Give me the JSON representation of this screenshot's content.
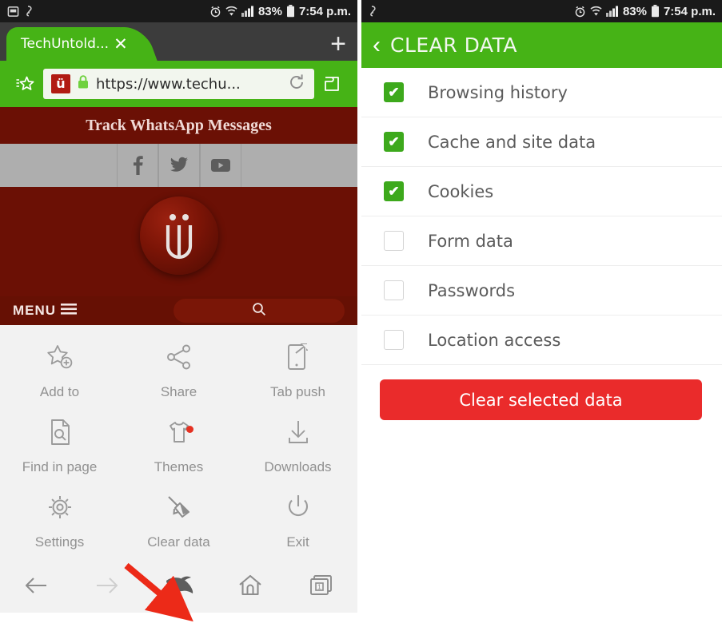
{
  "status_bar": {
    "left_icons": [
      "sdcard-icon",
      "app-notification-icon"
    ],
    "alarm_icon": "alarm-icon",
    "wifi_icon": "wifi-icon",
    "signal_icon": "signal-bars-icon",
    "battery_percent": "83%",
    "battery_icon": "battery-icon",
    "time": "7:54 p.m."
  },
  "browser": {
    "tab": {
      "title": "TechUntold...",
      "close_label": "✕"
    },
    "new_tab_label": "+",
    "bookmark_icon": "bookmark-star-icon",
    "favicon_letter": "ü",
    "lock_icon": "lock-icon",
    "url": "https://www.techu...",
    "reload_icon": "reload-icon",
    "extension_icon": "puzzle-extension-icon"
  },
  "webpage": {
    "title": "Track WhatsApp Messages",
    "social": [
      {
        "name": "facebook-icon",
        "glyph": "f"
      },
      {
        "name": "twitter-icon",
        "glyph": "t"
      },
      {
        "name": "youtube-icon",
        "glyph": "y"
      }
    ],
    "logo_letter": "ü",
    "menu_label": "MENU",
    "search_icon": "search-icon"
  },
  "menu_grid": {
    "rows": [
      [
        {
          "label": "Add to",
          "icon": "star-add-icon",
          "badge": false
        },
        {
          "label": "Share",
          "icon": "share-icon",
          "badge": false
        },
        {
          "label": "Tab push",
          "icon": "tab-push-icon",
          "badge": false
        }
      ],
      [
        {
          "label": "Find in page",
          "icon": "find-in-page-icon",
          "badge": false
        },
        {
          "label": "Themes",
          "icon": "themes-shirt-icon",
          "badge": true
        },
        {
          "label": "Downloads",
          "icon": "download-icon",
          "badge": false
        }
      ],
      [
        {
          "label": "Settings",
          "icon": "settings-gear-icon",
          "badge": false
        },
        {
          "label": "Clear data",
          "icon": "clear-data-broom-icon",
          "badge": false
        },
        {
          "label": "Exit",
          "icon": "power-exit-icon",
          "badge": false
        }
      ]
    ],
    "nav": [
      {
        "name": "back-icon"
      },
      {
        "name": "forward-icon"
      },
      {
        "name": "dolphin-logo-icon"
      },
      {
        "name": "home-icon"
      },
      {
        "name": "tabs-icon",
        "count": "1"
      }
    ]
  },
  "clear_data": {
    "back_label": "‹",
    "title": "CLEAR DATA",
    "items": [
      {
        "label": "Browsing history",
        "checked": true
      },
      {
        "label": "Cache and site data",
        "checked": true
      },
      {
        "label": "Cookies",
        "checked": true
      },
      {
        "label": "Form data",
        "checked": false
      },
      {
        "label": "Passwords",
        "checked": false
      },
      {
        "label": "Location access",
        "checked": false
      }
    ],
    "button_label": "Clear selected data"
  },
  "annotation": {
    "arrow_color": "#ec2a18",
    "points_to": "dolphin-logo-icon"
  },
  "colors": {
    "green": "#46b316",
    "dark_red": "#6b1005",
    "accent_red": "#ea2b2b",
    "status_bar": "#1a1a1a",
    "grid_bg": "#f2f2f2"
  }
}
